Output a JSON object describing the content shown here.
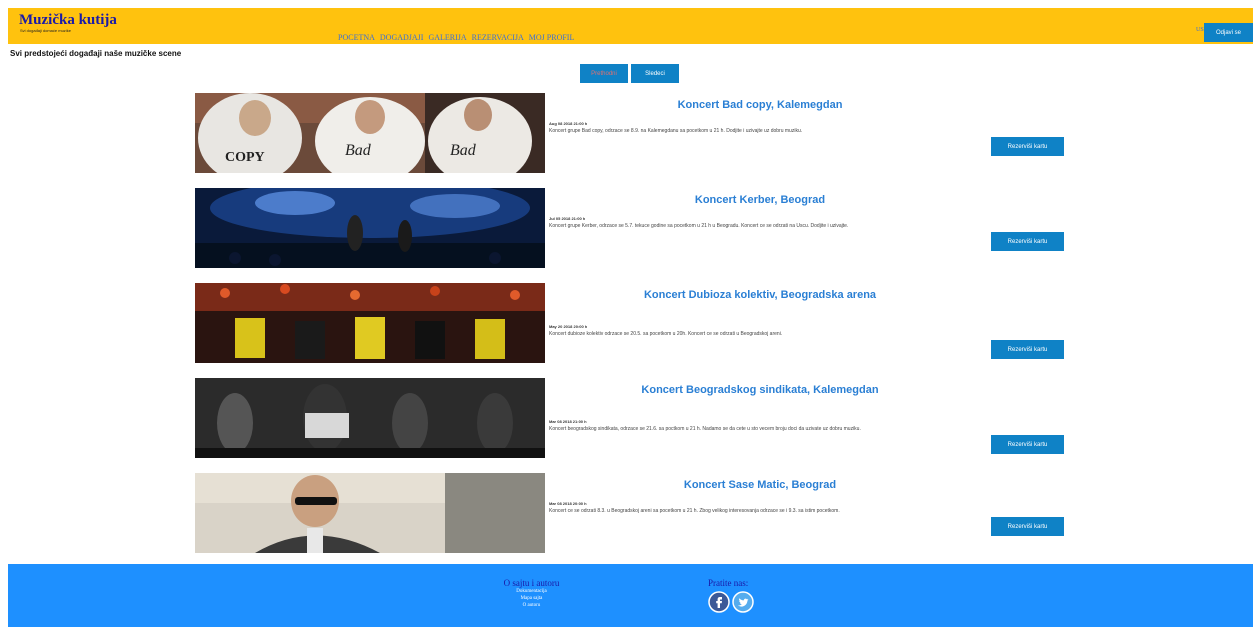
{
  "header": {
    "title": "Muzička kutija",
    "subtitle": "Svi događaji domaće muzike",
    "nav": [
      "POCETNA",
      "DOGADJAJI",
      "GALERIJA",
      "REZERVACIJA",
      "MOJ PROFIL"
    ],
    "user": "USER",
    "logout_label": "Odjavi se",
    "brand_color": "#FFC20E"
  },
  "main": {
    "heading": "Svi predstojeći događaji naše muzičke scene",
    "pager": {
      "prev": "Prethodni",
      "next": "Sledeci"
    },
    "reserve_label": "Rezerviši kartu",
    "events": [
      {
        "title": "Koncert Bad copy, Kalemegdan",
        "date": "Aug 08 2018 21:00 h",
        "description": "Koncert grupe Bad copy, odrzace se 8.9. na Kalemegdanu sa pocetkom u 21 h. Dodjite i uzivajte uz dobru muziku."
      },
      {
        "title": "Koncert Kerber, Beograd",
        "date": "Jul 05 2018 21:00 h",
        "description": "Koncert grupe Kerber, odrzace se 5.7. tekuce godine sa pocetkom u 21 h u Beogradu. Koncert ce se odrzati na Uscu. Dodjite i uzivajte."
      },
      {
        "title": "Koncert Dubioza kolektiv, Beogradska arena",
        "date": "May 20 2018 20:00 h",
        "description": "Koncert dubioze kolektiv odrzace se 20.5. sa pocetkom u 20h. Koncert ce se odrzati u Beogradskoj areni."
      },
      {
        "title": "Koncert Beogradskog sindikata, Kalemegdan",
        "date": "Mar 08 2018 21:00 h",
        "description": "Koncert beogradskog sindikata, odrzace se 21.6. sa poctkom u 21 h. Nadamo se da cete u sto vecem broju doci da uzivate uz dobru muziku."
      },
      {
        "title": "Koncert Sase Matic, Beograd",
        "date": "Mar 08 2018 20:00 h",
        "description": "Koncert ce se odrzati 8.3. u Beogradskoj areni sa pocetkom u 21 h. Zbog velikog interesovanja odrzace se i 9.3. sa istim pocetkom."
      }
    ],
    "accent_color": "#0f82c6"
  },
  "footer": {
    "about_title": "O sajtu i autoru",
    "links": [
      "Dokumentacija",
      "Mapa sajta",
      "O autoru"
    ],
    "follow_title": "Pratite nas:",
    "social_icons": [
      "facebook-icon",
      "twitter-icon"
    ],
    "background": "#1E90FF"
  }
}
